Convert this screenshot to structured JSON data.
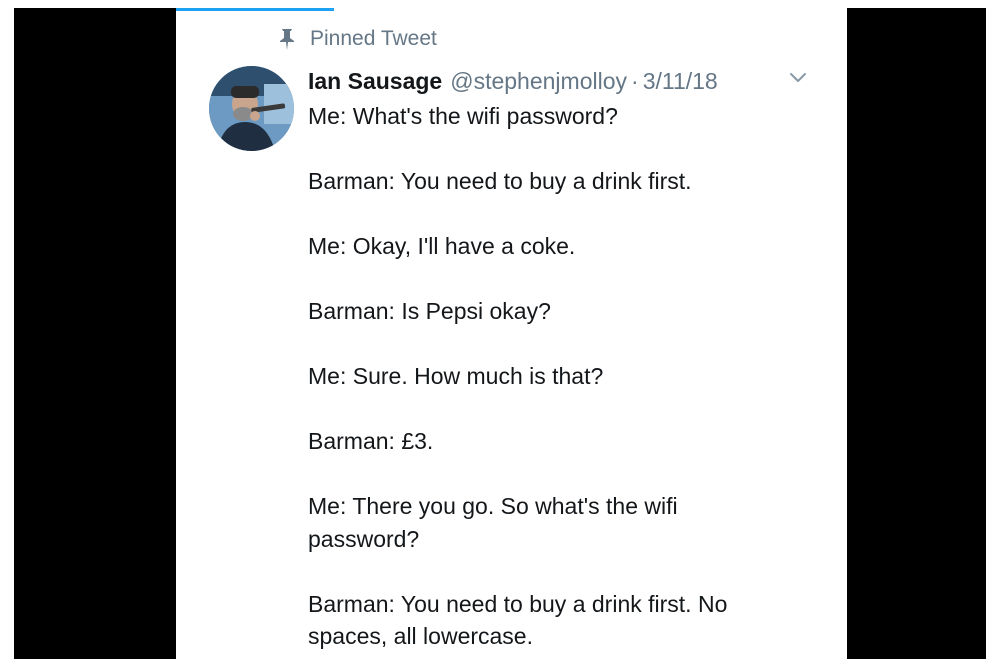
{
  "pinned_label": "Pinned Tweet",
  "author": {
    "name": "Ian Sausage",
    "handle": "@stephenjmolloy",
    "separator": "·",
    "date": "3/11/18"
  },
  "icons": {
    "pin": "pin-icon",
    "caret": "chevron-down-icon",
    "avatar": "avatar-photo"
  },
  "tweet_lines": [
    "Me: What's the wifi password?",
    "",
    "Barman: You need to buy a drink first.",
    "",
    "Me: Okay, I'll have a coke.",
    "",
    "Barman: Is Pepsi okay?",
    "",
    "Me: Sure. How much is that?",
    "",
    "Barman: £3.",
    "",
    "Me: There you go. So what's the wifi",
    "password?",
    "",
    "Barman: You need to buy a drink first. No",
    "spaces, all lowercase."
  ],
  "colors": {
    "frame": "#000000",
    "card": "#ffffff",
    "text": "#14171a",
    "muted": "#657786",
    "accent": "#1da1f2"
  }
}
